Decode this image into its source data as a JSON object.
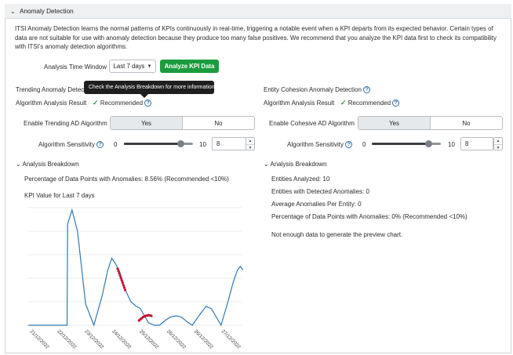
{
  "section": {
    "title": "Anomaly Detection"
  },
  "description": "ITSI Anomaly Detection learns the normal patterns of KPIs continuously in real-time, triggering a notable event when a KPI departs from its expected behavior. Certain types of data are not suitable for use with anomaly detection because they produce too many false positives. We recommend that you analyze the KPI data first to check its compatibility with ITSI's anomaly detection algorithms.",
  "analysis": {
    "window_label": "Analysis Time Window",
    "window_value": "Last 7 days",
    "analyze_button": "Analyze KPI Data"
  },
  "tooltip": "Check the Analysis Breakdown for more information.",
  "trending": {
    "title": "Trending Anomaly Detection",
    "result_label": "Algorithm Analysis Result",
    "result_value": "Recommended",
    "enable_label": "Enable Trending AD Algorithm",
    "yes": "Yes",
    "no": "No",
    "sensitivity_label": "Algorithm Sensitivity",
    "slider_min": "0",
    "slider_max": "10",
    "sensitivity_value": "8",
    "sensitivity_level": 8,
    "breakdown_title": "Analysis Breakdown",
    "pct_text": "Percentage of Data Points with Anomalies: 8.56% (Recommended <10%)",
    "chart_title": "KPI Value for Last 7 days"
  },
  "cohesion": {
    "title": "Entity Cohesion Anomaly Detection",
    "result_label": "Algorithm Analysis Result",
    "result_value": "Recommended",
    "enable_label": "Enable Cohesive AD Algorithm",
    "yes": "Yes",
    "no": "No",
    "sensitivity_label": "Algorithm Sensitivity",
    "slider_min": "0",
    "slider_max": "10",
    "sensitivity_value": "8",
    "sensitivity_level": 8,
    "breakdown_title": "Analysis Breakdown",
    "entities_analyzed": "Entities Analyzed: 10",
    "entities_detected": "Entities with Detected Anomalies: 0",
    "avg_anomalies": "Average Anomalies Per Entity: 0",
    "pct_text": "Percentage of Data Points with Anomalies: 0% (Recommended <10%)",
    "no_data": "Not enough data to generate the preview chart."
  },
  "colors": {
    "accent": "#1a9c3e",
    "line": "#2f78b5",
    "anomaly": "#c8102e"
  },
  "chart_data": {
    "type": "line",
    "title": "KPI Value for Last 7 days",
    "x_ticks": [
      "21/12/2022",
      "22/12/2022",
      "23/12/2022",
      "24/12/2022",
      "25/12/2022",
      "26/12/2022",
      "26/12/2022",
      "27/12/2022"
    ],
    "ylim": [
      0,
      100
    ],
    "series": [
      {
        "values": [
          [
            0.0,
            0
          ],
          [
            0.9,
            0
          ],
          [
            1.42,
            0
          ],
          [
            1.44,
            86
          ],
          [
            1.6,
            98
          ],
          [
            1.8,
            80
          ],
          [
            2.1,
            18
          ],
          [
            2.4,
            0
          ],
          [
            2.7,
            25
          ],
          [
            2.9,
            46
          ],
          [
            3.05,
            57
          ],
          [
            3.2,
            52
          ],
          [
            3.35,
            45
          ],
          [
            3.55,
            30
          ],
          [
            3.75,
            20
          ],
          [
            3.95,
            16
          ],
          [
            4.05,
            15
          ],
          [
            4.1,
            14
          ],
          [
            4.4,
            2
          ],
          [
            4.6,
            0
          ],
          [
            4.8,
            0
          ],
          [
            5.0,
            4
          ],
          [
            5.2,
            7
          ],
          [
            5.4,
            8
          ],
          [
            5.6,
            7
          ],
          [
            5.8,
            3
          ],
          [
            6.0,
            0
          ],
          [
            6.3,
            10
          ],
          [
            6.5,
            16
          ],
          [
            6.7,
            14
          ],
          [
            6.9,
            6
          ],
          [
            7.05,
            0
          ],
          [
            7.3,
            20
          ],
          [
            7.5,
            37
          ],
          [
            7.65,
            47
          ],
          [
            7.75,
            50
          ],
          [
            7.85,
            47
          ]
        ]
      }
    ],
    "anomalies": [
      [
        3.27,
        48
      ],
      [
        3.3,
        46
      ],
      [
        3.33,
        44
      ],
      [
        3.36,
        42
      ],
      [
        3.39,
        40
      ],
      [
        3.42,
        38
      ],
      [
        3.45,
        36
      ],
      [
        3.48,
        34
      ],
      [
        3.51,
        32
      ],
      [
        3.54,
        30
      ],
      [
        4.05,
        4
      ],
      [
        4.1,
        5
      ],
      [
        4.15,
        6
      ],
      [
        4.2,
        7
      ],
      [
        4.25,
        7.5
      ],
      [
        4.3,
        8
      ],
      [
        4.35,
        8.3
      ],
      [
        4.4,
        8.5
      ],
      [
        4.45,
        8.3
      ],
      [
        4.5,
        8
      ]
    ]
  }
}
